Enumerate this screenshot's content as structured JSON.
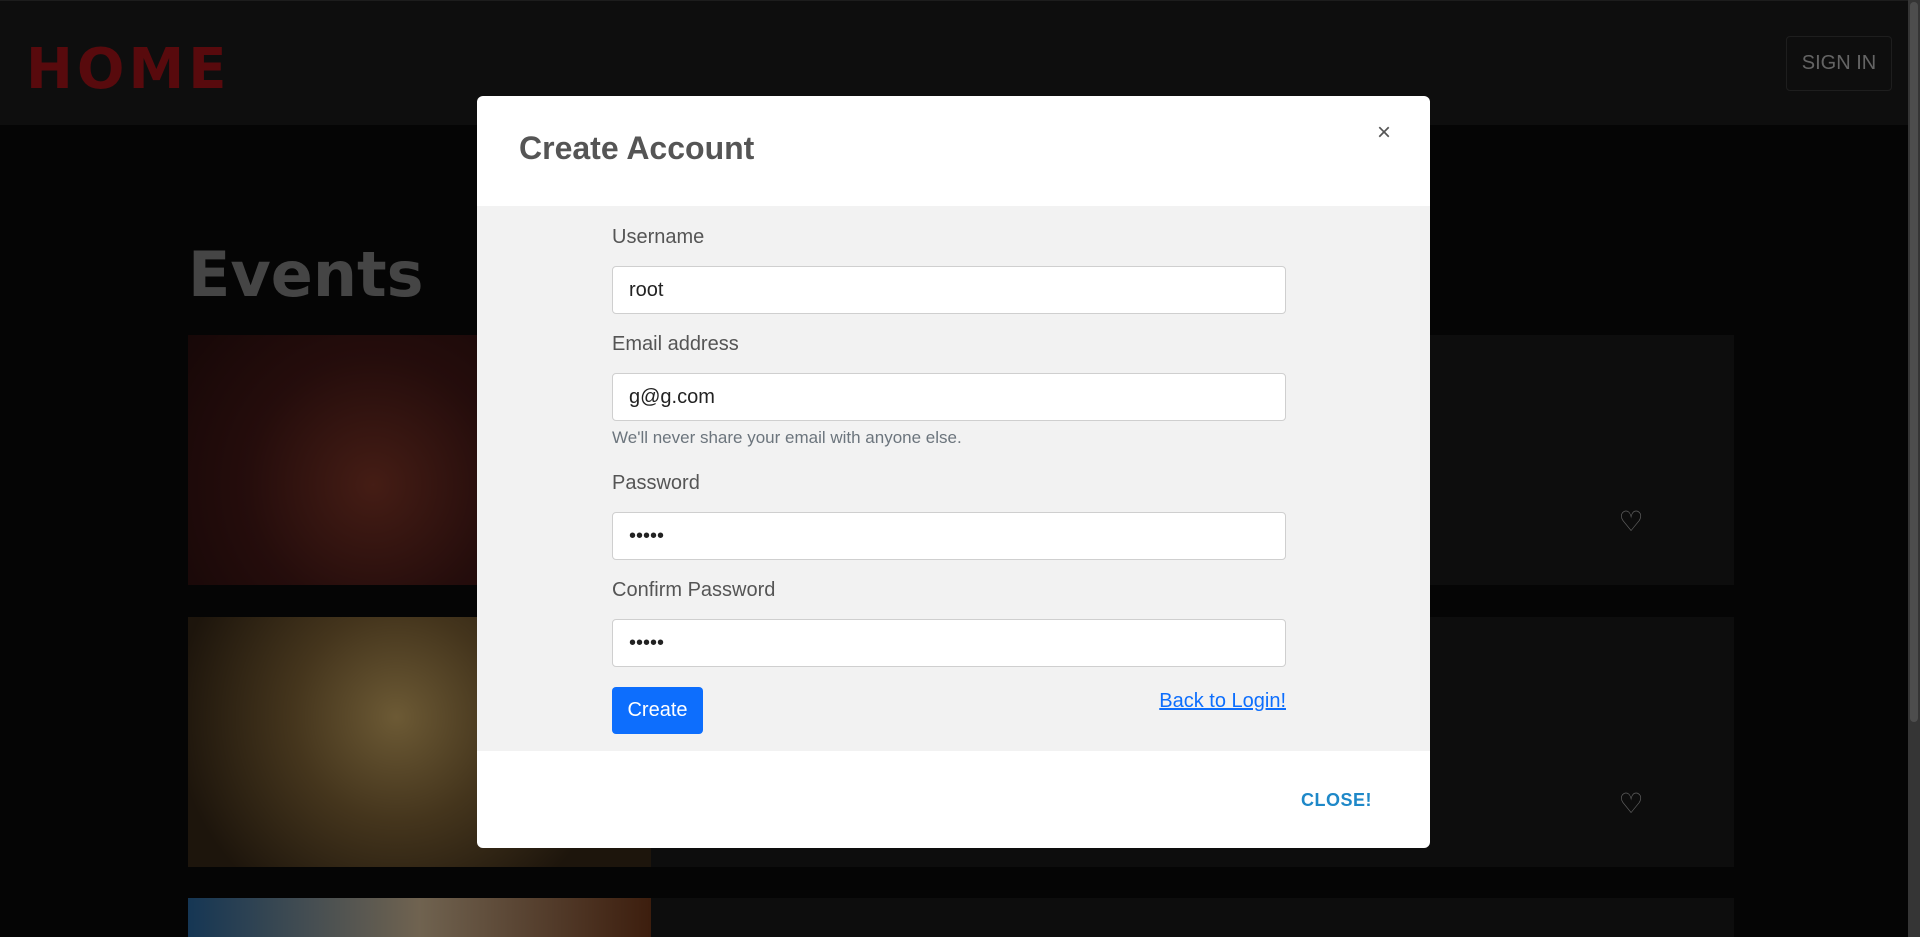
{
  "navbar": {
    "brand": "HOME",
    "signin_label": "SIGN IN"
  },
  "page": {
    "events_title": "Events"
  },
  "cards": [
    {
      "favorite_icon": "heart-icon"
    },
    {
      "favorite_icon": "heart-icon"
    },
    {
      "favorite_icon": "heart-icon"
    }
  ],
  "modal": {
    "title": "Create Account",
    "close_icon": "×",
    "fields": {
      "username": {
        "label": "Username",
        "value": "root"
      },
      "email": {
        "label": "Email address",
        "value": "g@g.com",
        "help": "We'll never share your email with anyone else."
      },
      "password": {
        "label": "Password",
        "value": "12345"
      },
      "confirm_password": {
        "label": "Confirm Password",
        "value": "12345"
      }
    },
    "create_label": "Create",
    "back_link": "Back to Login!",
    "close_label": "CLOSE!"
  },
  "colors": {
    "brand": "#b0151b",
    "primary": "#0d6efd",
    "close_link": "#1e88c8"
  }
}
